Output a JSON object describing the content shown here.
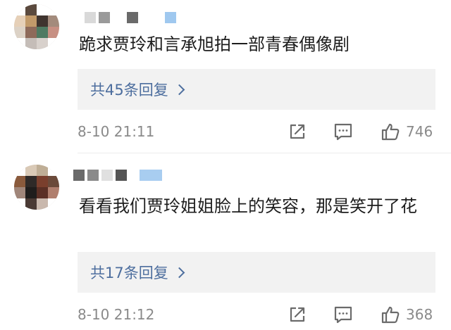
{
  "comments": [
    {
      "text": "跪求贾玲和言承旭拍一部青春偶像剧",
      "replies_label": "共45条回复",
      "timestamp": "8-10 21:11",
      "likes": "746",
      "name_blocks": [
        "#d9d9d9",
        "#9a9a9a",
        "#ffffff",
        "#6a6a6a",
        "#9fc8ef"
      ],
      "avatar_palette": [
        "#ffffff",
        "#5b4a3e",
        "#ffffff",
        "#ffffff",
        "#e6d0b8",
        "#c29a6a",
        "#3f342f",
        "#a38b7c",
        "#dcd2c6",
        "#8e6a5a",
        "#4f7a62",
        "#c79083",
        "#ffffff",
        "#c5bdb8",
        "#d8d1cc",
        "#ffffff"
      ]
    },
    {
      "text": "看看我们贾玲姐姐脸上的笑容，那是笑开了花",
      "replies_label": "共17条回复",
      "timestamp": "8-10 21:12",
      "likes": "368",
      "name_blocks": [
        "#6a6a6a",
        "#8a8a8a",
        "#e0e0e0",
        "#555555",
        "#a8cdf0"
      ],
      "avatar_palette": [
        "#ffffff",
        "#d9c9b6",
        "#bfae96",
        "#ffffff",
        "#8a5a3c",
        "#2f2a28",
        "#7a3f2d",
        "#6b4a3a",
        "#a0867a",
        "#1f1d1c",
        "#5a2f25",
        "#b07f6e",
        "#ffffff",
        "#4a3a34",
        "#c9b8ad",
        "#ffffff"
      ]
    }
  ],
  "icons": {
    "share": "share-icon",
    "reply": "comment-icon",
    "like": "thumbs-up-icon"
  }
}
